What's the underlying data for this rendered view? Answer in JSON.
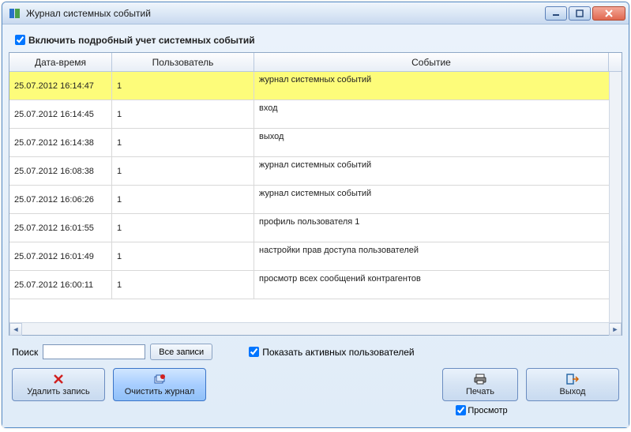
{
  "window": {
    "title": "Журнал системных событий"
  },
  "options": {
    "verboseLabel": "Включить подробный учет системных событий",
    "showActiveUsersLabel": "Показать активных пользователей"
  },
  "columns": {
    "datetime": "Дата-время",
    "user": "Пользователь",
    "event": "Событие"
  },
  "rows": [
    {
      "dt": "25.07.2012 16:14:47",
      "user": "1",
      "event": "журнал системных событий",
      "selected": true
    },
    {
      "dt": "25.07.2012 16:14:45",
      "user": "1",
      "event": "вход"
    },
    {
      "dt": "25.07.2012 16:14:38",
      "user": "1",
      "event": "выход"
    },
    {
      "dt": "25.07.2012 16:08:38",
      "user": "1",
      "event": "журнал системных событий"
    },
    {
      "dt": "25.07.2012 16:06:26",
      "user": "1",
      "event": "журнал системных событий"
    },
    {
      "dt": "25.07.2012 16:01:55",
      "user": "1",
      "event": "профиль пользователя 1"
    },
    {
      "dt": "25.07.2012 16:01:49",
      "user": "1",
      "event": "настройки прав доступа пользователей"
    },
    {
      "dt": "25.07.2012 16:00:11",
      "user": "1",
      "event": "просмотр всех сообщений контрагентов"
    }
  ],
  "search": {
    "label": "Поиск",
    "allRecords": "Все записи"
  },
  "buttons": {
    "delete": "Удалить запись",
    "clear": "Очистить журнал",
    "print": "Печать",
    "preview": "Просмотр",
    "exit": "Выход"
  }
}
